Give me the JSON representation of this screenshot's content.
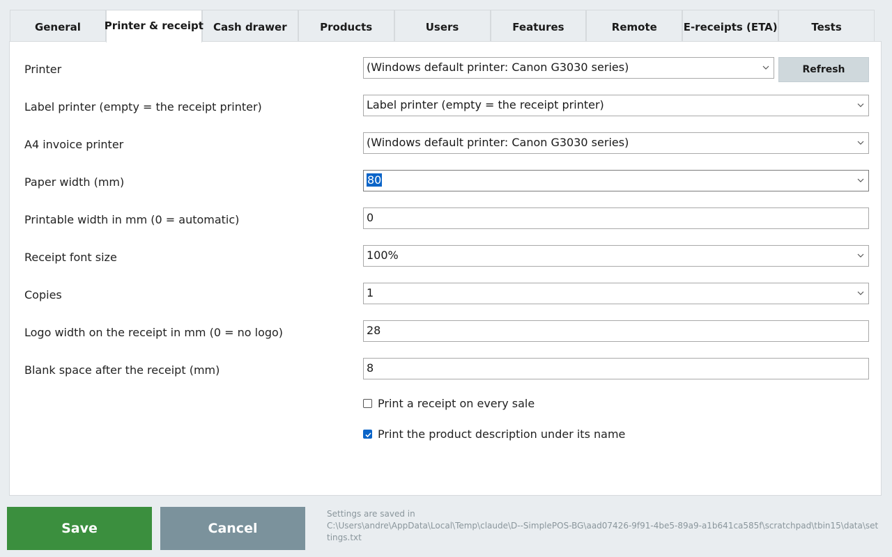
{
  "tabs": [
    {
      "label": "General",
      "active": false
    },
    {
      "label": "Printer & receipt",
      "active": true
    },
    {
      "label": "Cash drawer",
      "active": false
    },
    {
      "label": "Products",
      "active": false
    },
    {
      "label": "Users",
      "active": false
    },
    {
      "label": "Features",
      "active": false
    },
    {
      "label": "Remote",
      "active": false
    },
    {
      "label": "E-receipts (ETA)",
      "active": false
    },
    {
      "label": "Tests",
      "active": false
    }
  ],
  "settings": {
    "printer": {
      "label": "Printer",
      "value": "(Windows default printer: Canon G3030 series)"
    },
    "refresh_label": "Refresh",
    "label_printer": {
      "label": "Label printer (empty = the receipt printer)",
      "value": "Label printer (empty = the receipt printer)"
    },
    "a4_printer": {
      "label": "A4 invoice printer",
      "value": "(Windows default printer: Canon G3030 series)"
    },
    "paper_width": {
      "label": "Paper width (mm)",
      "value": "80"
    },
    "printable_width": {
      "label": "Printable width in mm (0 = automatic)",
      "value": "0"
    },
    "font_size": {
      "label": "Receipt font size",
      "value": "100%"
    },
    "copies": {
      "label": "Copies",
      "value": "1"
    },
    "logo_width": {
      "label": "Logo width on the receipt in mm (0 = no logo)",
      "value": "28"
    },
    "blank_space": {
      "label": "Blank space after the receipt (mm)",
      "value": "8"
    },
    "print_every_sale": {
      "label": "Print a receipt on every sale",
      "checked": false
    },
    "print_description": {
      "label": "Print the product description under its name",
      "checked": true
    }
  },
  "footer": {
    "save_label": "Save",
    "cancel_label": "Cancel",
    "saved_in_label": "Settings are saved in",
    "saved_path": "C:\\Users\\andre\\AppData\\Local\\Temp\\claude\\D--SimplePOS-BG\\aad07426-9f91-4be5-89a9-a1b641ca585f\\scratchpad\\tbin15\\data\\settings.txt"
  },
  "colors": {
    "accent": "#0a64c8",
    "save": "#3b8f3e",
    "cancel": "#7b929c"
  }
}
